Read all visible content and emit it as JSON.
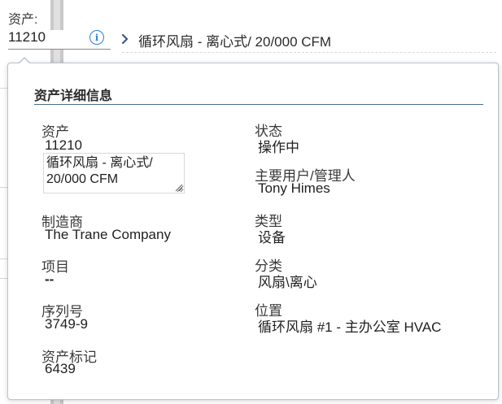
{
  "field": {
    "label": "资产:",
    "value": "11210",
    "description": "循环风扇 - 离心式/ 20/000 CFM"
  },
  "icons": {
    "info": "info-icon",
    "chevron": "chevron-right-icon",
    "resize": "resize-grip-icon"
  },
  "popover": {
    "title": "资产详细信息",
    "left": {
      "asset": {
        "label": "资产",
        "value": "11210",
        "description": "循环风扇 - 离心式/ 20/000 CFM"
      },
      "manufacturer": {
        "label": "制造商",
        "value": "The Trane Company"
      },
      "item": {
        "label": "项目",
        "value": "--"
      },
      "serial": {
        "label": "序列号",
        "value": "3749-9"
      },
      "tag": {
        "label": "资产标记",
        "value": "6439"
      }
    },
    "right": {
      "status": {
        "label": "状态",
        "value": "操作中"
      },
      "user": {
        "label": "主要用户/管理人",
        "value": "Tony Himes"
      },
      "type": {
        "label": "类型",
        "value": "设备"
      },
      "class": {
        "label": "分类",
        "value": "风扇\\离心"
      },
      "location": {
        "label": "位置",
        "value": "循环风扇 #1 - 主办公室 HVAC"
      }
    }
  },
  "colors": {
    "accent": "#2d7fd8",
    "rule": "#4a6d8c",
    "border": "#b9c3cf"
  }
}
